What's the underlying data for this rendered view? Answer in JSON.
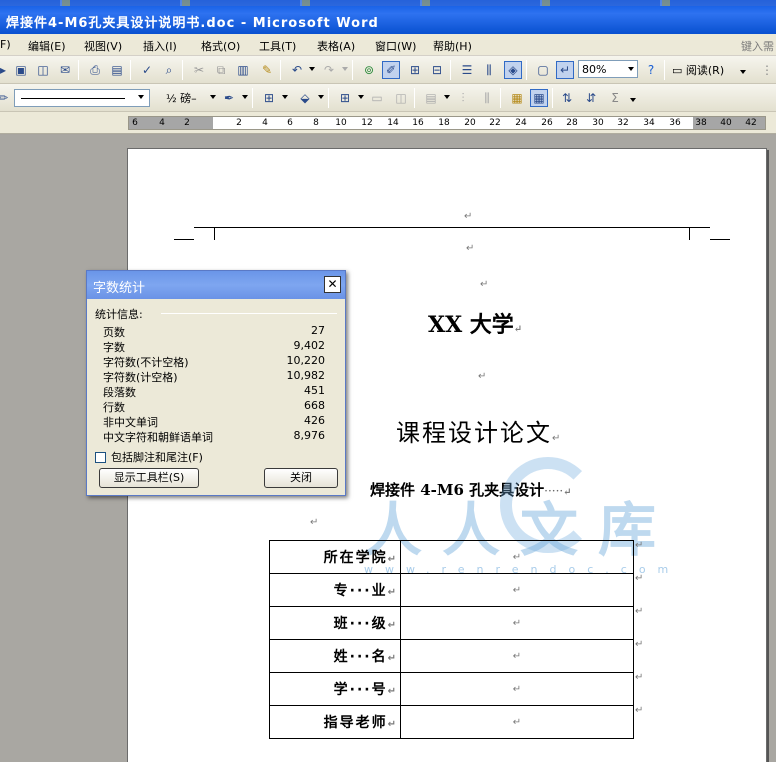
{
  "window": {
    "title": "焊接件4-M6孔夹具设计说明书.doc - Microsoft Word"
  },
  "menu": {
    "items": [
      {
        "label": "F)"
      },
      {
        "label": "编辑(E)"
      },
      {
        "label": "视图(V)"
      },
      {
        "label": "插入(I)"
      },
      {
        "label": "格式(O)"
      },
      {
        "label": "工具(T)"
      },
      {
        "label": "表格(A)"
      },
      {
        "label": "窗口(W)"
      },
      {
        "label": "帮助(H)"
      }
    ],
    "help_box_placeholder": "键入需"
  },
  "toolbar": {
    "zoom": "80%",
    "read_label": "阅读(R)",
    "line_weight": "½ 磅"
  },
  "ruler": {
    "ticks": [
      "6",
      "4",
      "2",
      "2",
      "4",
      "6",
      "8",
      "10",
      "12",
      "14",
      "16",
      "18",
      "20",
      "22",
      "24",
      "26",
      "28",
      "30",
      "32",
      "34",
      "36",
      "38",
      "40",
      "42"
    ]
  },
  "document": {
    "university": "XX 大学",
    "thesis_title": "课程设计论文",
    "subject": "焊接件 4-M6 孔夹具设计",
    "subject_dots": "·····",
    "para_mark": "↵",
    "table": [
      {
        "label": "所在学院",
        "value": ""
      },
      {
        "label": "专···业",
        "value": ""
      },
      {
        "label": "班···级",
        "value": ""
      },
      {
        "label": "姓···名",
        "value": ""
      },
      {
        "label": "学···号",
        "value": ""
      },
      {
        "label": "指导老师",
        "value": ""
      }
    ]
  },
  "watermark": {
    "text": "人人文库",
    "url": "www.renrendoc.com"
  },
  "word_count_dialog": {
    "title": "字数统计",
    "section_label": "统计信息:",
    "stats": [
      {
        "label": "页数",
        "value": "27"
      },
      {
        "label": "字数",
        "value": "9,402"
      },
      {
        "label": "字符数(不计空格)",
        "value": "10,220"
      },
      {
        "label": "字符数(计空格)",
        "value": "10,982"
      },
      {
        "label": "段落数",
        "value": "451"
      },
      {
        "label": "行数",
        "value": "668"
      },
      {
        "label": "非中文单词",
        "value": "426"
      },
      {
        "label": "中文字符和朝鲜语单词",
        "value": "8,976"
      }
    ],
    "include_footnotes_label": "包括脚注和尾注(F)",
    "include_footnotes_checked": false,
    "show_toolbar_label": "显示工具栏(S)",
    "close_label": "关闭"
  }
}
